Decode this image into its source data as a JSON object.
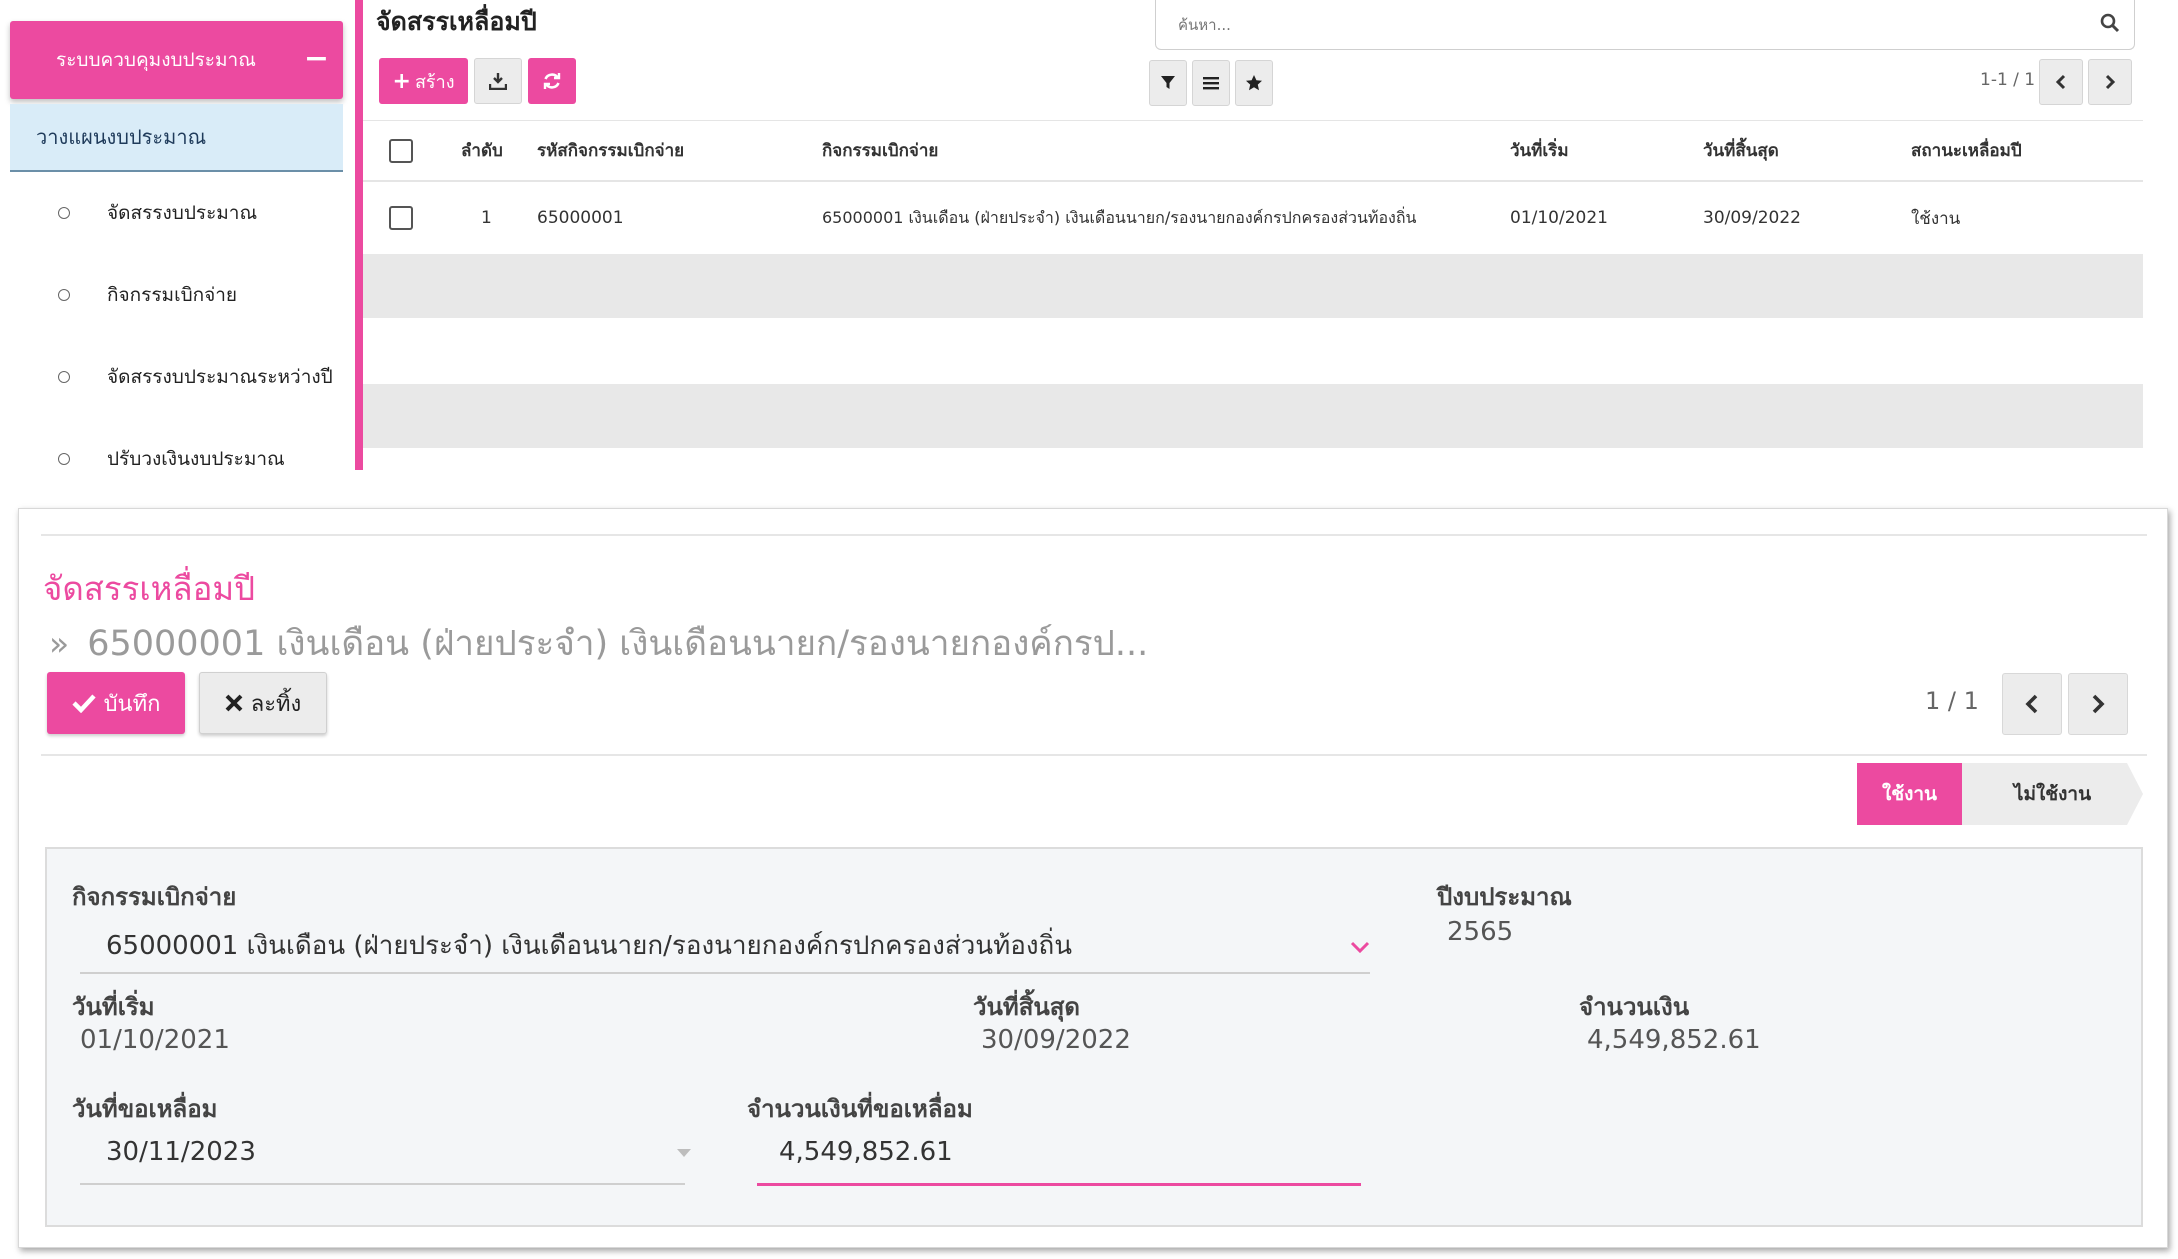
{
  "sidebar": {
    "header": "ระบบควบคุมงบประมาณ",
    "collapse_symbol": "−",
    "sub": "วางแผนงบประมาณ",
    "items": [
      {
        "label": "จัดสรรงบประมาณ"
      },
      {
        "label": "กิจกรรมเบิกจ่าย"
      },
      {
        "label": "จัดสรรงบประมาณระหว่างปี"
      },
      {
        "label": "ปรับวงเงินงบประมาณ"
      }
    ]
  },
  "list": {
    "title": "จัดสรรเหลื่อมปี",
    "create_label": "สร้าง",
    "search_placeholder": "ค้นหา...",
    "pager": "1-1 / 1",
    "columns": {
      "seq": "ลำดับ",
      "code": "รหัสกิจกรรมเบิกจ่าย",
      "activity": "กิจกรรมเบิกจ่าย",
      "start": "วันที่เริ่ม",
      "end": "วันที่สิ้นสุด",
      "status": "สถานะเหลื่อมปี"
    },
    "rows": [
      {
        "seq": "1",
        "code": "65000001",
        "activity": "65000001 เงินเดือน (ฝ่ายประจำ) เงินเดือนนายก/รองนายกองค์กรปกครองส่วนท้องถิ่น",
        "start": "01/10/2021",
        "end": "30/09/2022",
        "status": "ใช้งาน"
      }
    ]
  },
  "form": {
    "title": "จัดสรรเหลื่อมปี",
    "breadcrumb_chevron": "»",
    "breadcrumb": "65000001 เงินเดือน (ฝ่ายประจำ) เงินเดือนนายก/รองนายกองค์กรป...",
    "save_label": "บันทึก",
    "discard_label": "ละทิ้ง",
    "pager": "1 / 1",
    "status_active": "ใช้งาน",
    "status_inactive": "ไม่ใช้งาน",
    "fields": {
      "activity_label": "กิจกรรมเบิกจ่าย",
      "activity_value": "65000001 เงินเดือน (ฝ่ายประจำ) เงินเดือนนายก/รองนายกองค์กรปกครองส่วนท้องถิ่น",
      "fiscal_year_label": "ปีงบประมาณ",
      "fiscal_year_value": "2565",
      "start_label": "วันที่เริ่ม",
      "start_value": "01/10/2021",
      "end_label": "วันที่สิ้นสุด",
      "end_value": "30/09/2022",
      "amount_label": "จำนวนเงิน",
      "amount_value": "4,549,852.61",
      "request_date_label": "วันที่ขอเหลื่อม",
      "request_date_value": "30/11/2023",
      "request_amount_label": "จำนวนเงินที่ขอเหลื่อม",
      "request_amount_value": "4,549,852.61"
    }
  },
  "colors": {
    "accent": "#ec4aa0",
    "sidebar_sub_bg": "#d9ecf8",
    "button_grey": "#ececec"
  }
}
